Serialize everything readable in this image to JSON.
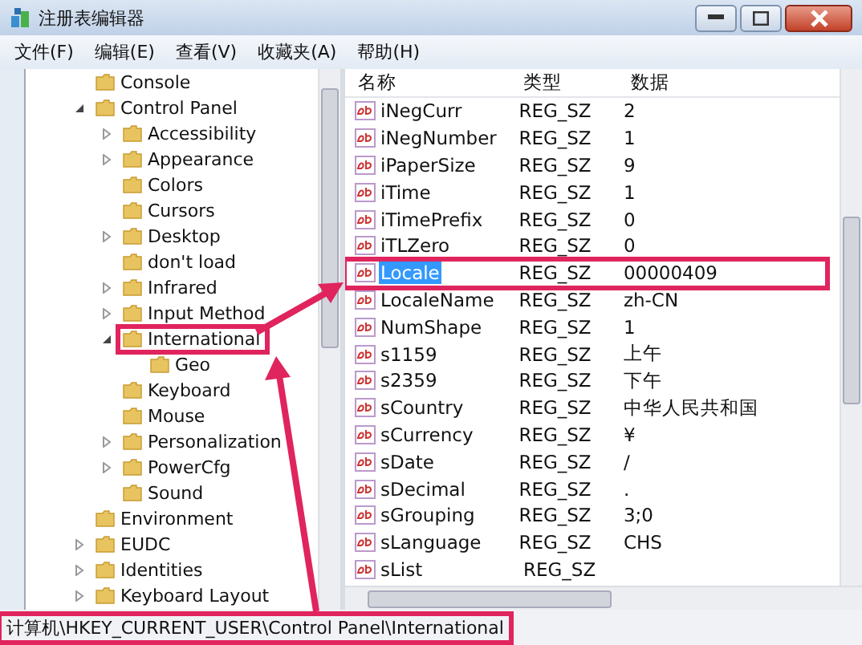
{
  "window": {
    "title": "注册表编辑器"
  },
  "menu": [
    "文件(F)",
    "编辑(E)",
    "查看(V)",
    "收藏夹(A)",
    "帮助(H)"
  ],
  "tree": [
    {
      "label": "Console"
    },
    {
      "label": "Control Panel",
      "expanded": true,
      "children": [
        {
          "label": "Accessibility",
          "expanded": false
        },
        {
          "label": "Appearance",
          "expanded": false
        },
        {
          "label": "Colors"
        },
        {
          "label": "Cursors"
        },
        {
          "label": "Desktop",
          "expanded": false
        },
        {
          "label": "don't load"
        },
        {
          "label": "Infrared",
          "expanded": false
        },
        {
          "label": "Input Method",
          "expanded": false
        },
        {
          "label": "International",
          "expanded": true,
          "highlighted": true,
          "children": [
            {
              "label": "Geo"
            }
          ]
        },
        {
          "label": "Keyboard"
        },
        {
          "label": "Mouse"
        },
        {
          "label": "Personalization",
          "expanded": false
        },
        {
          "label": "PowerCfg",
          "expanded": false
        },
        {
          "label": "Sound"
        }
      ]
    },
    {
      "label": "Environment"
    },
    {
      "label": "EUDC",
      "expanded": false
    },
    {
      "label": "Identities",
      "expanded": false
    },
    {
      "label": "Keyboard Layout",
      "expanded": false
    }
  ],
  "table": {
    "columns": [
      "名称",
      "类型",
      "数据"
    ],
    "rows": [
      {
        "name": "iNegCurr",
        "type": "REG_SZ",
        "data": "2",
        "selected": false
      },
      {
        "name": "iNegNumber",
        "type": "REG_SZ",
        "data": "1",
        "selected": false
      },
      {
        "name": "iPaperSize",
        "type": "REG_SZ",
        "data": "9",
        "selected": false
      },
      {
        "name": "iTime",
        "type": "REG_SZ",
        "data": "1",
        "selected": false
      },
      {
        "name": "iTimePrefix",
        "type": "REG_SZ",
        "data": "0",
        "selected": false
      },
      {
        "name": "iTLZero",
        "type": "REG_SZ",
        "data": "0",
        "selected": false
      },
      {
        "name": "Locale",
        "type": "REG_SZ",
        "data": "00000409",
        "selected": true,
        "highlighted": true
      },
      {
        "name": "LocaleName",
        "type": "REG_SZ",
        "data": "zh-CN",
        "selected": false
      },
      {
        "name": "NumShape",
        "type": "REG_SZ",
        "data": "1",
        "selected": false
      },
      {
        "name": "s1159",
        "type": "REG_SZ",
        "data": "上午",
        "selected": false
      },
      {
        "name": "s2359",
        "type": "REG_SZ",
        "data": "下午",
        "selected": false
      },
      {
        "name": "sCountry",
        "type": "REG_SZ",
        "data": "中华人民共和国",
        "selected": false
      },
      {
        "name": "sCurrency",
        "type": "REG_SZ",
        "data": "¥",
        "selected": false
      },
      {
        "name": "sDate",
        "type": "REG_SZ",
        "data": "/",
        "selected": false
      },
      {
        "name": "sDecimal",
        "type": "REG_SZ",
        "data": ".",
        "selected": false
      },
      {
        "name": "sGrouping",
        "type": "REG_SZ",
        "data": "3;0",
        "selected": false
      },
      {
        "name": "sLanguage",
        "type": "REG_SZ",
        "data": "CHS",
        "selected": false
      },
      {
        "name": "sList",
        "type": "REG_SZ",
        "selected": false
      }
    ]
  },
  "status_bar": {
    "text": "计算机\\HKEY_CURRENT_USER\\Control Panel\\International",
    "highlighted": true
  }
}
